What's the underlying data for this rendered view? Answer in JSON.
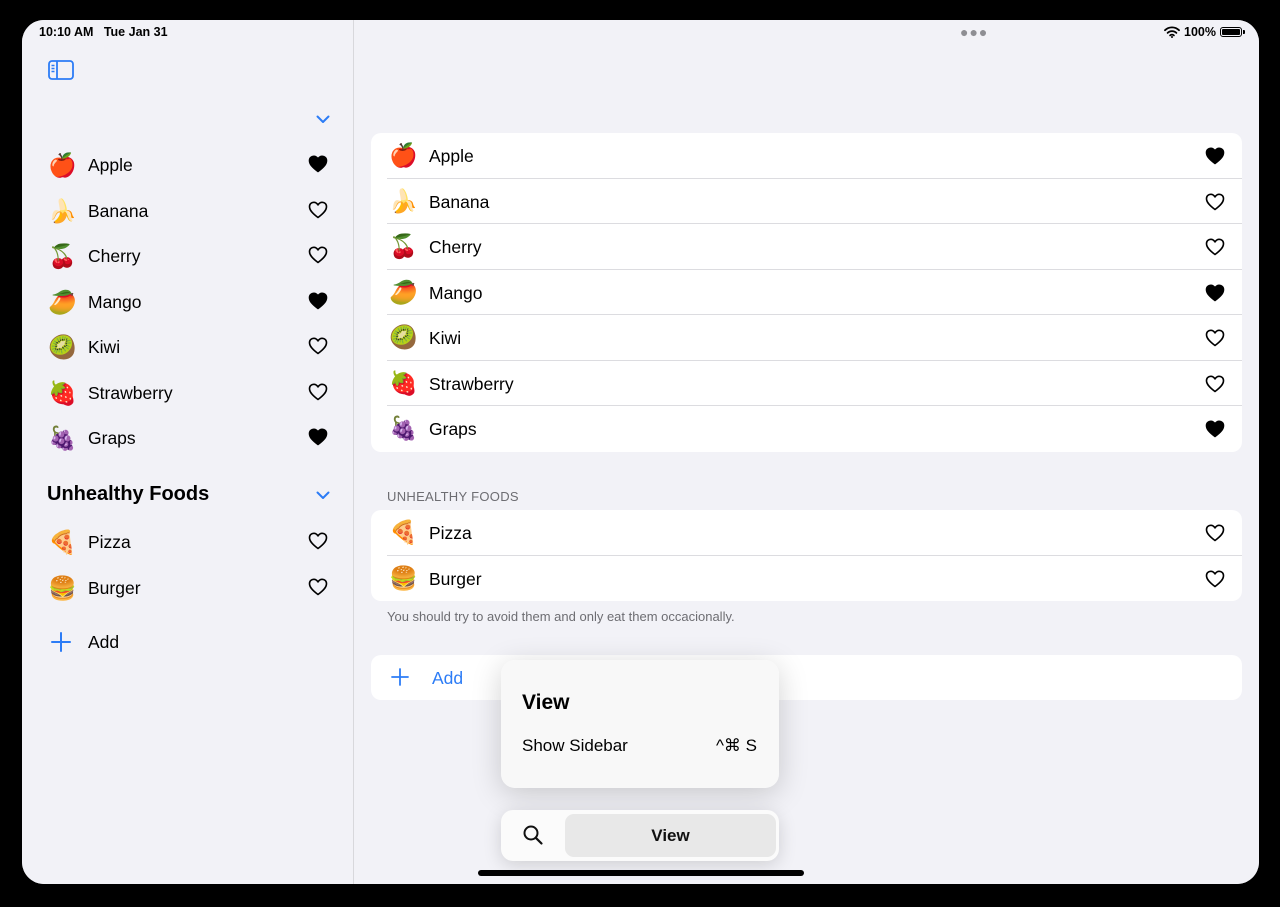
{
  "status": {
    "time": "10:10 AM",
    "date": "Tue Jan 31",
    "battery": "100%"
  },
  "colors": {
    "accent": "#2c7cf6",
    "background": "#f2f2f7"
  },
  "sidebar": {
    "items": [
      {
        "emoji": "🍎",
        "label": "Apple",
        "favorite": true
      },
      {
        "emoji": "🍌",
        "label": "Banana",
        "favorite": false
      },
      {
        "emoji": "🍒",
        "label": "Cherry",
        "favorite": false
      },
      {
        "emoji": "🥭",
        "label": "Mango",
        "favorite": true
      },
      {
        "emoji": "🥝",
        "label": "Kiwi",
        "favorite": false
      },
      {
        "emoji": "🍓",
        "label": "Strawberry",
        "favorite": false
      },
      {
        "emoji": "🍇",
        "label": "Graps",
        "favorite": true
      }
    ],
    "unhealthy_title": "Unhealthy Foods",
    "unhealthy_items": [
      {
        "emoji": "🍕",
        "label": "Pizza",
        "favorite": false
      },
      {
        "emoji": "🍔",
        "label": "Burger",
        "favorite": false
      }
    ],
    "add_label": "Add"
  },
  "main": {
    "items": [
      {
        "emoji": "🍎",
        "label": "Apple",
        "favorite": true
      },
      {
        "emoji": "🍌",
        "label": "Banana",
        "favorite": false
      },
      {
        "emoji": "🍒",
        "label": "Cherry",
        "favorite": false
      },
      {
        "emoji": "🥭",
        "label": "Mango",
        "favorite": true
      },
      {
        "emoji": "🥝",
        "label": "Kiwi",
        "favorite": false
      },
      {
        "emoji": "🍓",
        "label": "Strawberry",
        "favorite": false
      },
      {
        "emoji": "🍇",
        "label": "Graps",
        "favorite": true
      }
    ],
    "unhealthy_header": "UNHEALTHY FOODS",
    "unhealthy_items": [
      {
        "emoji": "🍕",
        "label": "Pizza",
        "favorite": false
      },
      {
        "emoji": "🍔",
        "label": "Burger",
        "favorite": false
      }
    ],
    "unhealthy_footer": "You should try to avoid them and only eat them occacionally.",
    "add_label": "Add"
  },
  "popover": {
    "title": "View",
    "item_label": "Show Sidebar",
    "shortcut": "^⌘ S"
  },
  "toolbar": {
    "view_label": "View"
  },
  "icons": {
    "sidebar_toggle": "sidebar-toggle-icon",
    "chevron": "chevron-down-icon",
    "heart_filled": "heart-filled-icon",
    "heart_outline": "heart-outline-icon",
    "plus": "plus-icon",
    "search": "magnifying-glass-icon",
    "wifi": "wifi-icon",
    "battery": "battery-icon"
  }
}
